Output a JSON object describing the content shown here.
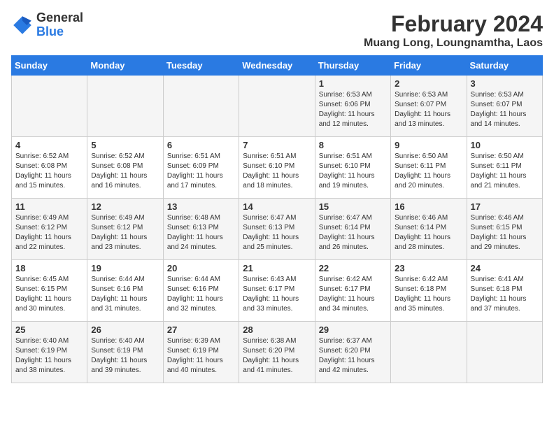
{
  "header": {
    "logo": {
      "general": "General",
      "blue": "Blue"
    },
    "title": "February 2024",
    "subtitle": "Muang Long, Loungnamtha, Laos"
  },
  "days_of_week": [
    "Sunday",
    "Monday",
    "Tuesday",
    "Wednesday",
    "Thursday",
    "Friday",
    "Saturday"
  ],
  "weeks": [
    [
      {
        "day": "",
        "info": ""
      },
      {
        "day": "",
        "info": ""
      },
      {
        "day": "",
        "info": ""
      },
      {
        "day": "",
        "info": ""
      },
      {
        "day": "1",
        "info": "Sunrise: 6:53 AM\nSunset: 6:06 PM\nDaylight: 11 hours and 12 minutes."
      },
      {
        "day": "2",
        "info": "Sunrise: 6:53 AM\nSunset: 6:07 PM\nDaylight: 11 hours and 13 minutes."
      },
      {
        "day": "3",
        "info": "Sunrise: 6:53 AM\nSunset: 6:07 PM\nDaylight: 11 hours and 14 minutes."
      }
    ],
    [
      {
        "day": "4",
        "info": "Sunrise: 6:52 AM\nSunset: 6:08 PM\nDaylight: 11 hours and 15 minutes."
      },
      {
        "day": "5",
        "info": "Sunrise: 6:52 AM\nSunset: 6:08 PM\nDaylight: 11 hours and 16 minutes."
      },
      {
        "day": "6",
        "info": "Sunrise: 6:51 AM\nSunset: 6:09 PM\nDaylight: 11 hours and 17 minutes."
      },
      {
        "day": "7",
        "info": "Sunrise: 6:51 AM\nSunset: 6:10 PM\nDaylight: 11 hours and 18 minutes."
      },
      {
        "day": "8",
        "info": "Sunrise: 6:51 AM\nSunset: 6:10 PM\nDaylight: 11 hours and 19 minutes."
      },
      {
        "day": "9",
        "info": "Sunrise: 6:50 AM\nSunset: 6:11 PM\nDaylight: 11 hours and 20 minutes."
      },
      {
        "day": "10",
        "info": "Sunrise: 6:50 AM\nSunset: 6:11 PM\nDaylight: 11 hours and 21 minutes."
      }
    ],
    [
      {
        "day": "11",
        "info": "Sunrise: 6:49 AM\nSunset: 6:12 PM\nDaylight: 11 hours and 22 minutes."
      },
      {
        "day": "12",
        "info": "Sunrise: 6:49 AM\nSunset: 6:12 PM\nDaylight: 11 hours and 23 minutes."
      },
      {
        "day": "13",
        "info": "Sunrise: 6:48 AM\nSunset: 6:13 PM\nDaylight: 11 hours and 24 minutes."
      },
      {
        "day": "14",
        "info": "Sunrise: 6:47 AM\nSunset: 6:13 PM\nDaylight: 11 hours and 25 minutes."
      },
      {
        "day": "15",
        "info": "Sunrise: 6:47 AM\nSunset: 6:14 PM\nDaylight: 11 hours and 26 minutes."
      },
      {
        "day": "16",
        "info": "Sunrise: 6:46 AM\nSunset: 6:14 PM\nDaylight: 11 hours and 28 minutes."
      },
      {
        "day": "17",
        "info": "Sunrise: 6:46 AM\nSunset: 6:15 PM\nDaylight: 11 hours and 29 minutes."
      }
    ],
    [
      {
        "day": "18",
        "info": "Sunrise: 6:45 AM\nSunset: 6:15 PM\nDaylight: 11 hours and 30 minutes."
      },
      {
        "day": "19",
        "info": "Sunrise: 6:44 AM\nSunset: 6:16 PM\nDaylight: 11 hours and 31 minutes."
      },
      {
        "day": "20",
        "info": "Sunrise: 6:44 AM\nSunset: 6:16 PM\nDaylight: 11 hours and 32 minutes."
      },
      {
        "day": "21",
        "info": "Sunrise: 6:43 AM\nSunset: 6:17 PM\nDaylight: 11 hours and 33 minutes."
      },
      {
        "day": "22",
        "info": "Sunrise: 6:42 AM\nSunset: 6:17 PM\nDaylight: 11 hours and 34 minutes."
      },
      {
        "day": "23",
        "info": "Sunrise: 6:42 AM\nSunset: 6:18 PM\nDaylight: 11 hours and 35 minutes."
      },
      {
        "day": "24",
        "info": "Sunrise: 6:41 AM\nSunset: 6:18 PM\nDaylight: 11 hours and 37 minutes."
      }
    ],
    [
      {
        "day": "25",
        "info": "Sunrise: 6:40 AM\nSunset: 6:19 PM\nDaylight: 11 hours and 38 minutes."
      },
      {
        "day": "26",
        "info": "Sunrise: 6:40 AM\nSunset: 6:19 PM\nDaylight: 11 hours and 39 minutes."
      },
      {
        "day": "27",
        "info": "Sunrise: 6:39 AM\nSunset: 6:19 PM\nDaylight: 11 hours and 40 minutes."
      },
      {
        "day": "28",
        "info": "Sunrise: 6:38 AM\nSunset: 6:20 PM\nDaylight: 11 hours and 41 minutes."
      },
      {
        "day": "29",
        "info": "Sunrise: 6:37 AM\nSunset: 6:20 PM\nDaylight: 11 hours and 42 minutes."
      },
      {
        "day": "",
        "info": ""
      },
      {
        "day": "",
        "info": ""
      }
    ]
  ]
}
